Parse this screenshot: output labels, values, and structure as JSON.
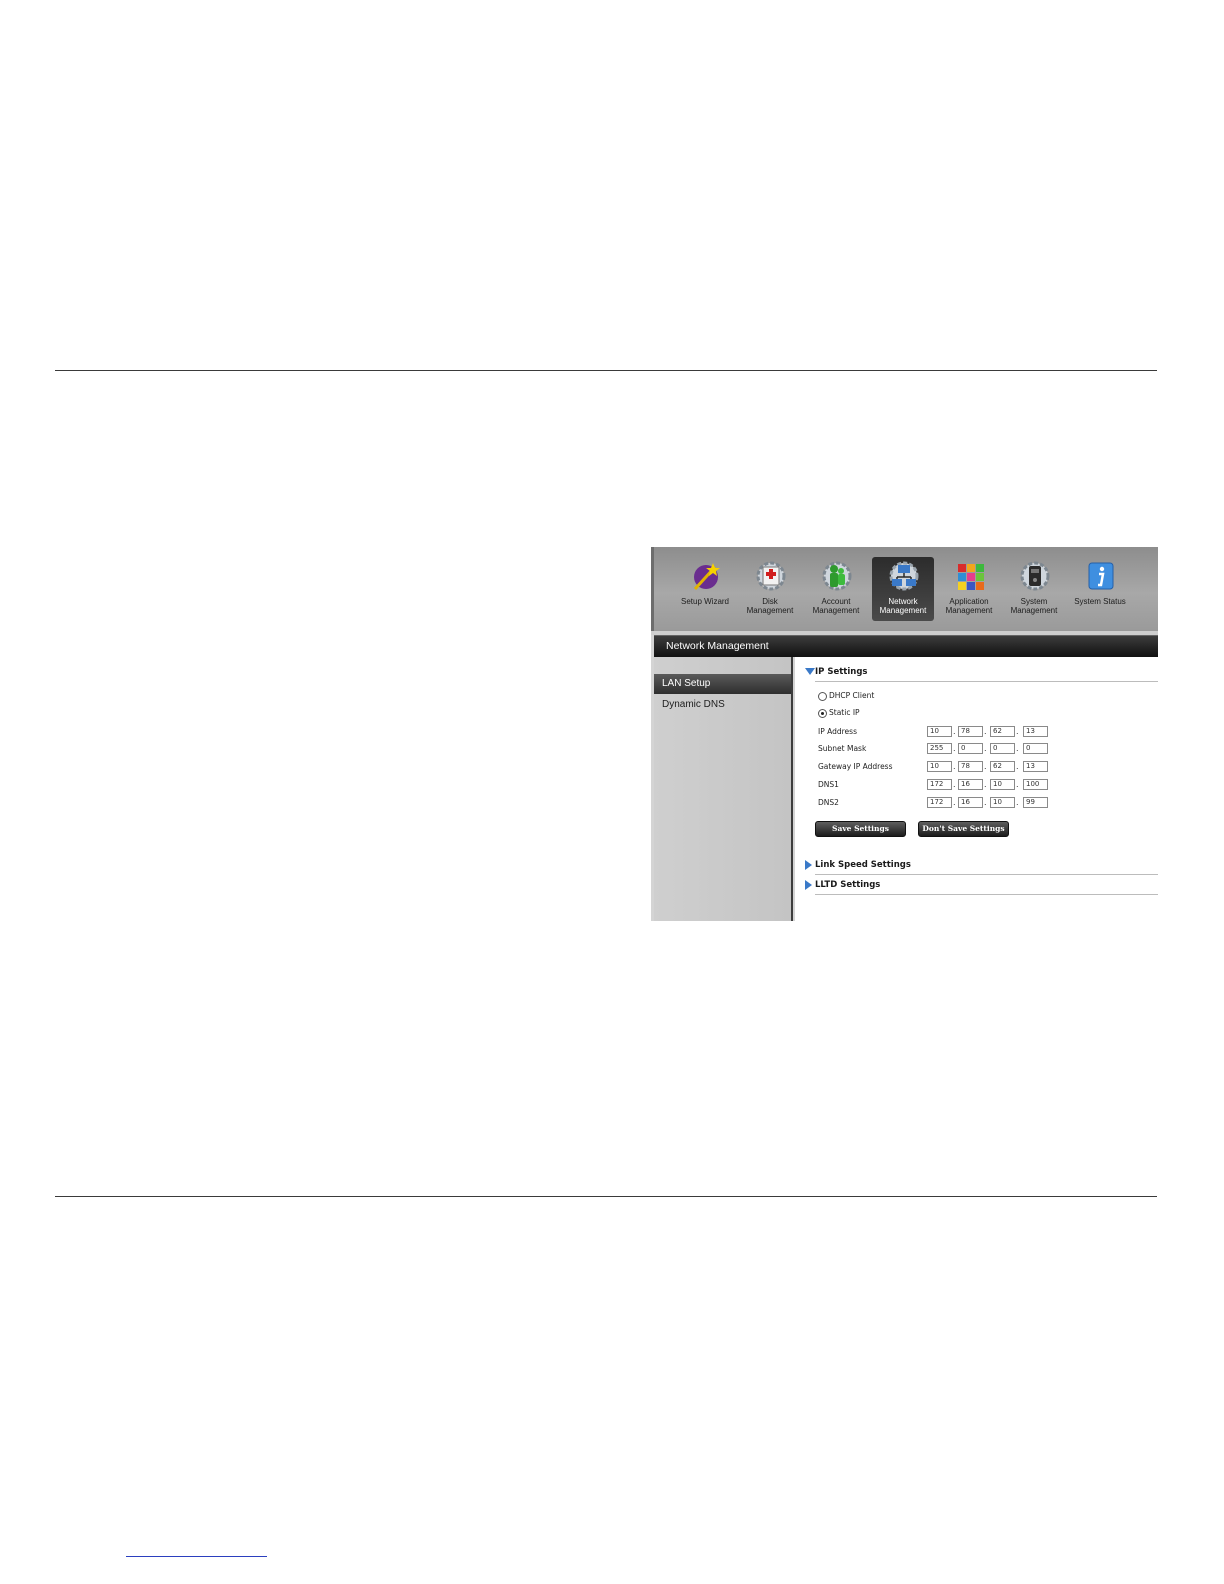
{
  "nav": {
    "items": [
      {
        "label": "Setup Wizard"
      },
      {
        "label": "Disk Management"
      },
      {
        "label": "Account Management"
      },
      {
        "label": "Network Management"
      },
      {
        "label": "Application Management"
      },
      {
        "label": "System Management"
      },
      {
        "label": "System Status"
      }
    ],
    "active_index": 3
  },
  "page_title": "Network Management",
  "sidebar": {
    "items": [
      {
        "label": "LAN Setup"
      },
      {
        "label": "Dynamic DNS"
      }
    ]
  },
  "ip_settings": {
    "title": "IP Settings",
    "radio_dhcp": "DHCP Client",
    "radio_static": "Static IP",
    "selected": "Static IP",
    "fields": [
      {
        "label": "IP Address",
        "octets": [
          "10",
          "78",
          "62",
          "13"
        ]
      },
      {
        "label": "Subnet Mask",
        "octets": [
          "255",
          "0",
          "0",
          "0"
        ]
      },
      {
        "label": "Gateway IP Address",
        "octets": [
          "10",
          "78",
          "62",
          "13"
        ]
      },
      {
        "label": "DNS1",
        "octets": [
          "172",
          "16",
          "10",
          "100"
        ]
      },
      {
        "label": "DNS2",
        "octets": [
          "172",
          "16",
          "10",
          "99"
        ]
      }
    ],
    "save_label": "Save Settings",
    "dont_save_label": "Don't Save Settings"
  },
  "sections": {
    "link_speed": "Link Speed Settings",
    "lltd": "LLTD Settings"
  },
  "colors": {
    "accent_blue": "#3a79c8",
    "title_bar": "#1a1a1a",
    "toolbar_gray": "#9e9e9e"
  }
}
